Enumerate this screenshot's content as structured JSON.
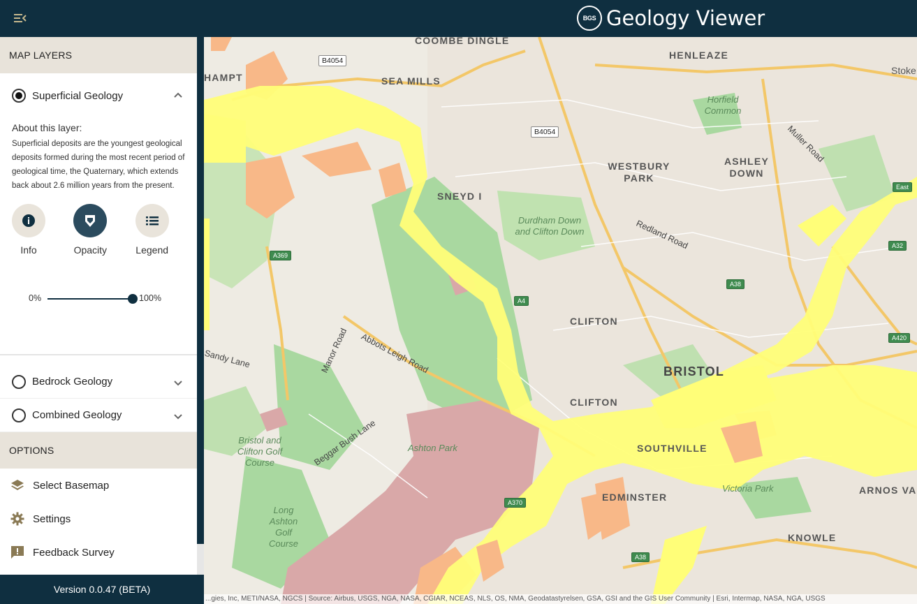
{
  "header": {
    "title": "Geology Viewer",
    "logo_text": "BGS"
  },
  "sidebar": {
    "map_layers_heading": "MAP LAYERS",
    "layers": [
      {
        "label": "Superficial Geology",
        "selected": true,
        "expanded": true
      },
      {
        "label": "Bedrock Geology",
        "selected": false,
        "expanded": false
      },
      {
        "label": "Combined Geology",
        "selected": false,
        "expanded": false
      }
    ],
    "about": {
      "title": "About this layer:",
      "text": "Superficial deposits are the youngest geological deposits formed during the most recent period of geological time, the Quaternary, which extends back about 2.6 million years from the present."
    },
    "tools": [
      {
        "label": "Info",
        "icon": "info-icon"
      },
      {
        "label": "Opacity",
        "icon": "opacity-icon",
        "active": true
      },
      {
        "label": "Legend",
        "icon": "legend-icon"
      }
    ],
    "opacity": {
      "min_label": "0%",
      "max_label": "100%",
      "value": 1.0
    },
    "options_heading": "OPTIONS",
    "options": [
      {
        "label": "Select Basemap",
        "icon": "layers-icon"
      },
      {
        "label": "Settings",
        "icon": "gear-icon"
      },
      {
        "label": "Feedback Survey",
        "icon": "feedback-icon"
      }
    ],
    "version": "Version 0.0.47 (BETA)"
  },
  "map": {
    "place_labels": [
      "COOMBE DINGLE",
      "HENLEAZE",
      "SEA MILLS",
      "WESTBURY PARK",
      "ASHLEY DOWN",
      "SNEYD I",
      "CLIFTON",
      "BRISTOL",
      "CLIFTON",
      "SOUTHVILLE",
      "ARNOS VA",
      "EDMINSTER",
      "KNOWLE",
      "HAMPT",
      "Stoke"
    ],
    "park_labels": [
      "Horfield Common",
      "Durdham Down and Clifton Down",
      "Bristol and Clifton Golf Course",
      "Ashton Park",
      "Long Ashton Golf Course",
      "Victoria Park"
    ],
    "road_labels": [
      "Muller Road",
      "Redland Road",
      "Abbots Leigh Road",
      "Manor Road",
      "Sandy Lane",
      "Beggar Bush Lane"
    ],
    "shields": [
      "B4054",
      "B4054",
      "A369",
      "A38",
      "A4",
      "A420",
      "A370",
      "A38",
      "A32",
      "East"
    ],
    "attribution": "...gies, Inc, METI/NASA, NGCS | Source: Airbus, USGS, NGA, NASA, CGIAR, NCEAS, NLS, OS, NMA, Geodatastyrelsen, GSA, GSI and the GIS User Community | Esri, Intermap, NASA, NGA, USGS"
  },
  "colors": {
    "header": "#0f2f40",
    "section": "#e8e3da",
    "alluvium": "#fffe78",
    "head": "#f8b888",
    "peat": "#d9a8a8",
    "park": "#a9d8a0"
  }
}
